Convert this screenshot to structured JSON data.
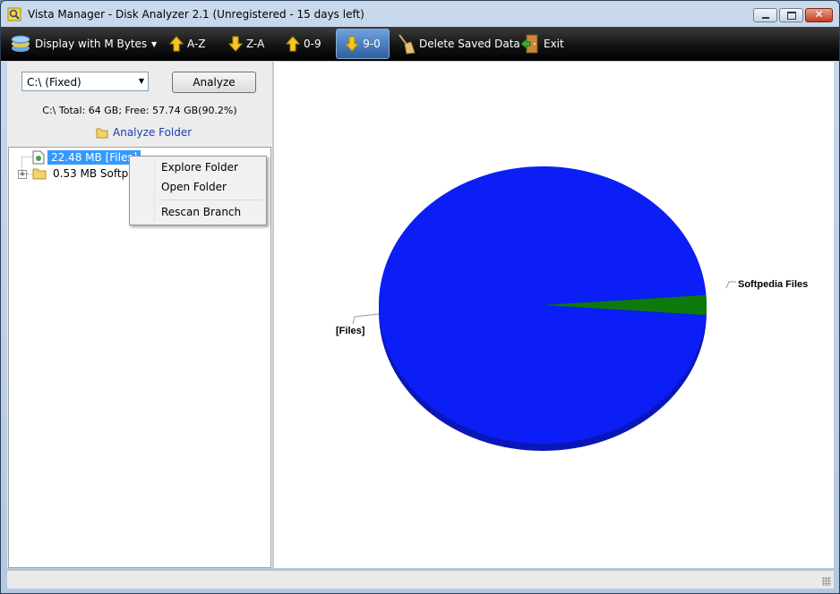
{
  "window": {
    "title": "Vista Manager - Disk Analyzer 2.1 (Unregistered - 15 days left)",
    "close_glyph": "✕"
  },
  "toolbar": {
    "display_label": "Display with M Bytes",
    "dropdown_glyph": "▼",
    "az_label": "A-Z",
    "za_label": "Z-A",
    "sort09_label": "0-9",
    "sort90_label": "9-0",
    "delete_label": "Delete Saved Data",
    "exit_label": "Exit",
    "active_sort": "9-0"
  },
  "left": {
    "drive_select_value": "C:\\ (Fixed)",
    "drive_select_arrow": "▼",
    "analyze_label": "Analyze",
    "drive_info": "C:\\ Total: 64 GB; Free: 57.74 GB(90.2%)",
    "analyze_folder_label": "Analyze Folder"
  },
  "tree": {
    "expander_glyph": "+",
    "nodes": [
      {
        "label": "22.48 MB [Files]",
        "selected": true,
        "icon": "file-icon"
      },
      {
        "label": "0.53 MB Softpedia Files",
        "selected": false,
        "icon": "folder-icon"
      }
    ]
  },
  "context_menu": {
    "items": [
      {
        "label": "Explore Folder"
      },
      {
        "label": "Open Folder"
      },
      {
        "label": "Rescan Branch"
      }
    ]
  },
  "chart_data": {
    "type": "pie",
    "slices": [
      {
        "label": "[Files]",
        "value": 22.48,
        "color": "#0b1ef5"
      },
      {
        "label": "Softpedia Files",
        "value": 0.53,
        "color": "#0d7a0d"
      }
    ]
  }
}
